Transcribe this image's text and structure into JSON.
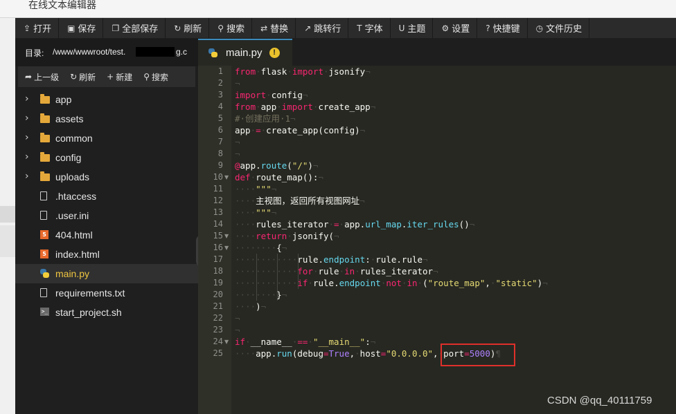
{
  "window": {
    "title": "在线文本编辑器"
  },
  "toolbar": {
    "buttons": [
      {
        "label": "打开",
        "icon": "upload-icon"
      },
      {
        "label": "保存",
        "icon": "save-icon"
      },
      {
        "label": "全部保存",
        "icon": "save-all-icon"
      },
      {
        "label": "刷新",
        "icon": "refresh-icon"
      },
      {
        "label": "搜索",
        "icon": "search-icon"
      },
      {
        "label": "替换",
        "icon": "replace-icon"
      },
      {
        "label": "跳转行",
        "icon": "goto-line-icon"
      },
      {
        "label": "字体",
        "icon": "font-icon"
      },
      {
        "label": "主题",
        "icon": "theme-icon"
      },
      {
        "label": "设置",
        "icon": "gear-icon"
      },
      {
        "label": "快捷键",
        "icon": "help-icon"
      },
      {
        "label": "文件历史",
        "icon": "history-icon"
      }
    ]
  },
  "sidebar": {
    "dir_label": "目录:",
    "dir_path": "/www/wwwroot/test.",
    "dir_suffix": "g.c",
    "actions": {
      "up": "上一级",
      "refresh": "刷新",
      "new": "新建",
      "search": "搜索"
    },
    "items": [
      {
        "name": "app",
        "type": "folder"
      },
      {
        "name": "assets",
        "type": "folder"
      },
      {
        "name": "common",
        "type": "folder"
      },
      {
        "name": "config",
        "type": "folder"
      },
      {
        "name": "uploads",
        "type": "folder"
      },
      {
        "name": ".htaccess",
        "type": "file"
      },
      {
        "name": ".user.ini",
        "type": "file"
      },
      {
        "name": "404.html",
        "type": "html"
      },
      {
        "name": "index.html",
        "type": "html"
      },
      {
        "name": "main.py",
        "type": "python",
        "active": true
      },
      {
        "name": "requirements.txt",
        "type": "file"
      },
      {
        "name": "start_project.sh",
        "type": "shell"
      }
    ]
  },
  "editor": {
    "tab": {
      "label": "main.py",
      "warning": "!"
    },
    "line_numbers": [
      "1",
      "2",
      "3",
      "4",
      "5",
      "6",
      "7",
      "8",
      "9",
      "10",
      "11",
      "12",
      "13",
      "14",
      "15",
      "16",
      "17",
      "18",
      "19",
      "20",
      "21",
      "22",
      "23",
      "24",
      "25"
    ],
    "lines": [
      "from·flask·import·jsonify¬",
      "¬",
      "import·config¬",
      "from·app·import·create_app¬",
      "#·创建应用·1¬",
      "app·=·create_app(config)¬",
      "¬",
      "¬",
      "@app.route(\"/\")¬",
      "def·route_map():¬",
      "····\"\"\"¬",
      "····主视图，返回所有视图网址¬",
      "····\"\"\"¬",
      "····rules_iterator·=·app.url_map.iter_rules()¬",
      "····return·jsonify(¬",
      "········{¬",
      "············rule.endpoint:·rule.rule¬",
      "············for·rule·in·rules_iterator¬",
      "············if·rule.endpoint·not·in·(\"route_map\",·\"static\")¬",
      "········}¬",
      "····)¬",
      "¬",
      "¬",
      "if·__name__·==·\"__main__\":¬",
      "····app.run(debug=True,·host=\"0.0.0.0\",·port=5000)¶"
    ]
  },
  "watermark": "CSDN @qq_40111759",
  "colors": {
    "keyword": "#f92672",
    "string": "#e6db74",
    "function": "#66d9ef",
    "number": "#ae81ff",
    "comment": "#75715e",
    "highlight_box": "#e0302b",
    "active_file": "#f0c640"
  }
}
